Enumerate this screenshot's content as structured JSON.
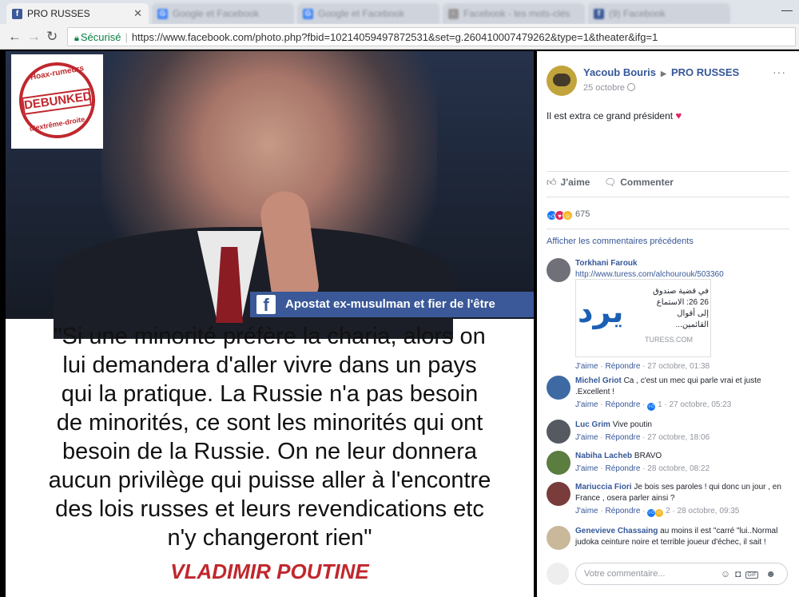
{
  "browser": {
    "tabs": [
      {
        "label": "PRO RUSSES",
        "active": true
      },
      {
        "label": "Google et Facebook",
        "active": false
      },
      {
        "label": "Google et Facebook",
        "active": false
      },
      {
        "label": "Facebook - les mots-clés",
        "active": false
      },
      {
        "label": "(9) Facebook",
        "active": false
      }
    ],
    "secure_label": "Sécurisé",
    "url": "https://www.facebook.com/photo.php?fbid=10214059497872531&set=g.260410007479262&type=1&theater&ifg=1"
  },
  "photo": {
    "sticker": {
      "top_text": "Hoax-rumeurs",
      "stamp": "DEBUNKED",
      "bottom_text": "d'extrême-droite"
    },
    "banner_fb": "f",
    "banner_text": "Apostat ex-musulman et fier de l'être",
    "quote_lines": [
      "\"Si une minorité préfère la charia, alors on",
      "lui demandera d'aller vivre dans un pays",
      "qui la pratique. La Russie n'a pas besoin",
      "de minorités, ce sont les minorités qui ont",
      "besoin de la Russie. On ne leur donnera",
      "aucun privilège qui puisse aller à l'encontre",
      "des lois russes et leurs revendications etc",
      "n'y changeront rien\""
    ],
    "signature": "VLADIMIR POUTINE"
  },
  "post": {
    "author": "Yacoub Bouris",
    "arrow": "▶",
    "group": "PRO RUSSES",
    "date": "25 octobre",
    "more": "···",
    "text": "Il est extra ce grand président",
    "heart": "♥",
    "like_label": "J'aime",
    "comment_label": "Commenter",
    "reaction_count": "675",
    "prev_comments": "Afficher les commentaires précédents"
  },
  "comments": [
    {
      "name": "Torkhani Farouk",
      "text": "",
      "link": "http://www.turess.com/alchourouk/503360",
      "preview_title": "في قضية صندوق 26 26: الاستماع إلى أقوال القائمين...",
      "preview_src": "TURESS.COM",
      "preview_logo": "ﻳﺮﺩ",
      "like": "J'aime",
      "reply": "Répondre",
      "reactions": "",
      "time": "27 octobre, 01:38",
      "avatar_color": "#6f7078"
    },
    {
      "name": "Michel Griot",
      "text": "Ca , c'est un mec qui parle vrai et juste .Excellent !",
      "like": "J'aime",
      "reply": "Répondre",
      "reactions": "1",
      "time": "27 octobre, 05:23",
      "avatar_color": "#3d6aa3"
    },
    {
      "name": "Luc Grim",
      "text": "Vive poutin",
      "like": "J'aime",
      "reply": "Répondre",
      "reactions": "",
      "time": "27 octobre, 18:06",
      "avatar_color": "#555a60"
    },
    {
      "name": "Nabiha Lacheb",
      "text": "BRAVO",
      "like": "J'aime",
      "reply": "Répondre",
      "reactions": "",
      "time": "28 octobre, 08:22",
      "avatar_color": "#5b7d3f"
    },
    {
      "name": "Mariuccia Fiori",
      "text": "Je bois ses paroles ! qui donc un jour , en France , osera parler ainsi ?",
      "like": "J'aime",
      "reply": "Répondre",
      "reactions": "2",
      "time": "28 octobre, 09:35",
      "avatar_color": "#7a3b3b"
    },
    {
      "name": "Genevieve Chassaing",
      "text": "au moins il est \"carré \"lui..Normal judoka ceinture noire et terrible joueur d'échec, il sait !",
      "like": "",
      "reply": "",
      "reactions": "",
      "time": "",
      "avatar_color": "#c9b89a"
    }
  ],
  "compose": {
    "placeholder": "Votre commentaire..."
  }
}
